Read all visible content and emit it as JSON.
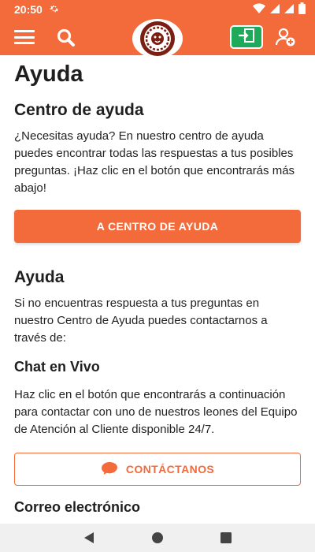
{
  "status_bar": {
    "time": "20:50",
    "gear_icon": "settings-gear-icon",
    "icons": [
      "wifi-icon",
      "signal-icon",
      "signal-icon",
      "battery-icon"
    ]
  },
  "header": {
    "menu_icon": "hamburger-menu-icon",
    "search_icon": "search-icon",
    "logo_icon": "lion-logo-icon",
    "login_icon": "login-icon",
    "register_icon": "add-user-icon",
    "accent": "#f36b3b",
    "login_color": "#1faa5b"
  },
  "page": {
    "title": "Ayuda",
    "help_center": {
      "heading": "Centro de ayuda",
      "text": "¿Necesitas ayuda? En nuestro centro de ayuda puedes encontrar todas las respuestas a tus posibles preguntas. ¡Haz clic en el botón que encontrarás más abajo!",
      "button": "A CENTRO DE AYUDA"
    },
    "help": {
      "heading": "Ayuda",
      "text": "Si no encuentras respuesta a tus preguntas en nuestro Centro de Ayuda puedes contactarnos a través de:"
    },
    "live_chat": {
      "heading": "Chat en Vivo",
      "text": "Haz clic en el botón que encontrarás a continuación para contactar con uno de nuestros leones del Equipo de Atención al Cliente disponible 24/7.",
      "button": "CONTÁCTANOS",
      "button_icon": "chat-bubble-icon"
    },
    "email": {
      "heading": "Correo electrónico"
    }
  },
  "nav_bar": {
    "back_icon": "back-triangle-icon",
    "home_icon": "home-circle-icon",
    "recents_icon": "recents-square-icon"
  }
}
